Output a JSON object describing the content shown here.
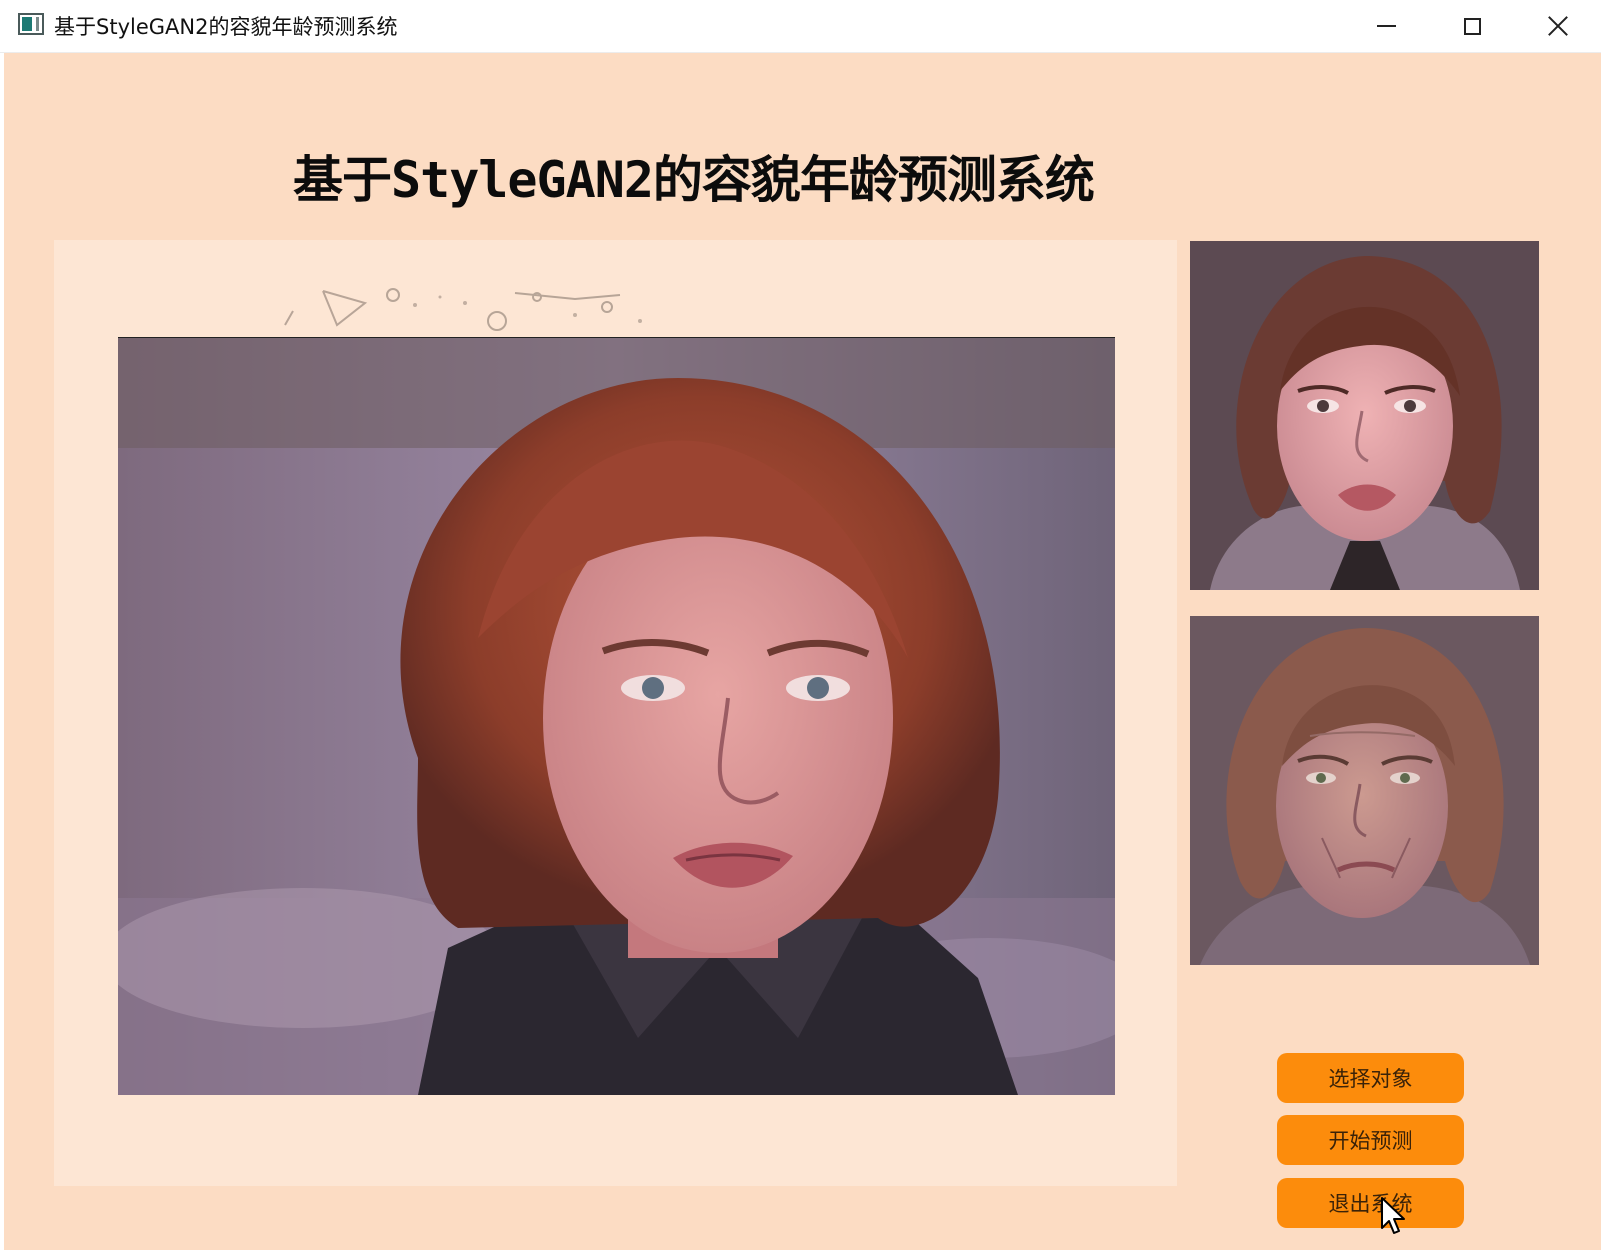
{
  "window": {
    "title": "基于StyleGAN2的容貌年龄预测系统",
    "controls": {
      "minimize": "minimize",
      "maximize": "maximize",
      "close": "close"
    }
  },
  "header": {
    "title": "基于StyleGAN2的容貌年龄预测系统"
  },
  "images": {
    "input": "input-face-photo",
    "younger_result": "younger-face-result",
    "older_result": "older-face-result"
  },
  "buttons": {
    "select_label": "选择对象",
    "start_label": "开始预测",
    "exit_label": "退出系统"
  },
  "colors": {
    "background": "#fcdcc3",
    "panel": "#fde6d4",
    "button": "#fc8c0c",
    "button_text": "#3a2208"
  }
}
